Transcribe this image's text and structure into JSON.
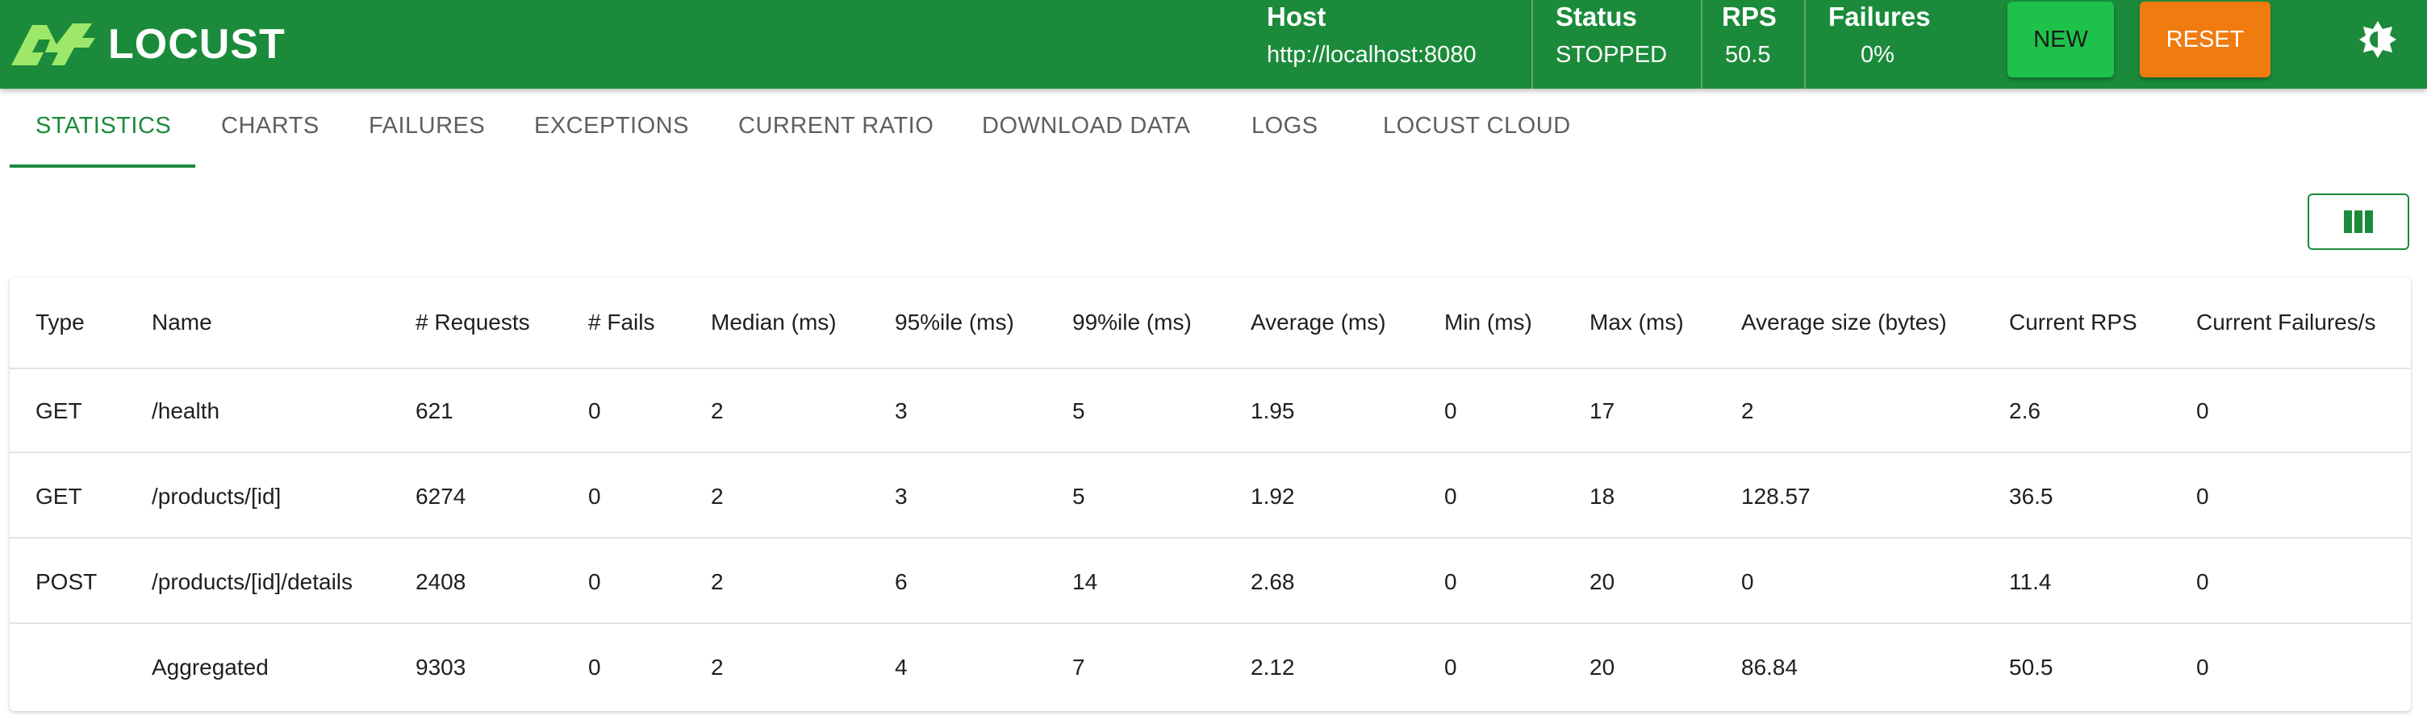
{
  "brand": {
    "name": "LOCUST"
  },
  "status_bar": {
    "host": {
      "label": "Host",
      "value": "http://localhost:8080"
    },
    "status": {
      "label": "Status",
      "value": "STOPPED"
    },
    "rps": {
      "label": "RPS",
      "value": "50.5"
    },
    "failures": {
      "label": "Failures",
      "value": "0%"
    }
  },
  "buttons": {
    "new": "NEW",
    "reset": "RESET",
    "theme_icon": "brightness-icon"
  },
  "tabs": [
    {
      "label": "STATISTICS",
      "active": true
    },
    {
      "label": "CHARTS"
    },
    {
      "label": "FAILURES"
    },
    {
      "label": "EXCEPTIONS"
    },
    {
      "label": "CURRENT RATIO"
    },
    {
      "label": "DOWNLOAD DATA"
    },
    {
      "label": "LOGS"
    },
    {
      "label": "LOCUST CLOUD"
    }
  ],
  "column_toggle_icon": "view-columns-icon",
  "table": {
    "headers": [
      "Type",
      "Name",
      "# Requests",
      "# Fails",
      "Median (ms)",
      "95%ile (ms)",
      "99%ile (ms)",
      "Average (ms)",
      "Min (ms)",
      "Max (ms)",
      "Average size (bytes)",
      "Current RPS",
      "Current Failures/s"
    ],
    "rows": [
      [
        "GET",
        "/health",
        "621",
        "0",
        "2",
        "3",
        "5",
        "1.95",
        "0",
        "17",
        "2",
        "2.6",
        "0"
      ],
      [
        "GET",
        "/products/[id]",
        "6274",
        "0",
        "2",
        "3",
        "5",
        "1.92",
        "0",
        "18",
        "128.57",
        "36.5",
        "0"
      ],
      [
        "POST",
        "/products/[id]/details",
        "2408",
        "0",
        "2",
        "6",
        "14",
        "2.68",
        "0",
        "20",
        "0",
        "11.4",
        "0"
      ],
      [
        "",
        "Aggregated",
        "9303",
        "0",
        "2",
        "4",
        "7",
        "2.12",
        "0",
        "20",
        "86.84",
        "50.5",
        "0"
      ]
    ]
  },
  "colors": {
    "brand_green": "#1b8b3b",
    "new_button": "#1ec24b",
    "reset_button": "#f07c10"
  }
}
